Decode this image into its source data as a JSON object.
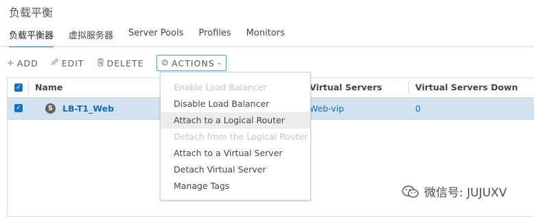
{
  "page": {
    "title": "负载平衡"
  },
  "tabs": [
    {
      "label": "负载平衡器",
      "active": true
    },
    {
      "label": "虚拟服务器",
      "active": false
    },
    {
      "label": "Server Pools",
      "active": false
    },
    {
      "label": "Profiles",
      "active": false
    },
    {
      "label": "Monitors",
      "active": false
    }
  ],
  "toolbar": {
    "add": "ADD",
    "edit": "EDIT",
    "delete": "DELETE",
    "actions": "ACTIONS",
    "icons": {
      "add": "plus-icon",
      "edit": "pencil-icon",
      "delete": "trash-icon",
      "actions": "gear-icon"
    }
  },
  "grid": {
    "columns": {
      "name": "Name",
      "virtual_servers": "Virtual Servers",
      "virtual_servers_down": "Virtual Servers Down"
    },
    "rows": [
      {
        "selected": true,
        "status_icon": "S",
        "name": "LB-T1_Web",
        "virtual_servers": "Web-vip",
        "virtual_servers_down": "0"
      }
    ]
  },
  "actions_menu": {
    "items": [
      {
        "label": "Enable Load Balancer",
        "disabled": true
      },
      {
        "label": "Disable Load Balancer",
        "disabled": false
      },
      {
        "label": "Attach to a Logical Router",
        "disabled": false,
        "hovered": true
      },
      {
        "label": "Detach from the Logical Router",
        "disabled": true
      },
      {
        "label": "Attach to a Virtual Server",
        "disabled": false
      },
      {
        "label": "Detach Virtual Server",
        "disabled": false
      },
      {
        "label": "Manage Tags",
        "disabled": false
      }
    ]
  },
  "watermark": {
    "text": "微信号: JUJUXV"
  },
  "colors": {
    "accent": "#1b72b8",
    "selected_row": "#d3e2ef",
    "link": "#1b6bb0",
    "disabled": "#c4c4c4"
  }
}
